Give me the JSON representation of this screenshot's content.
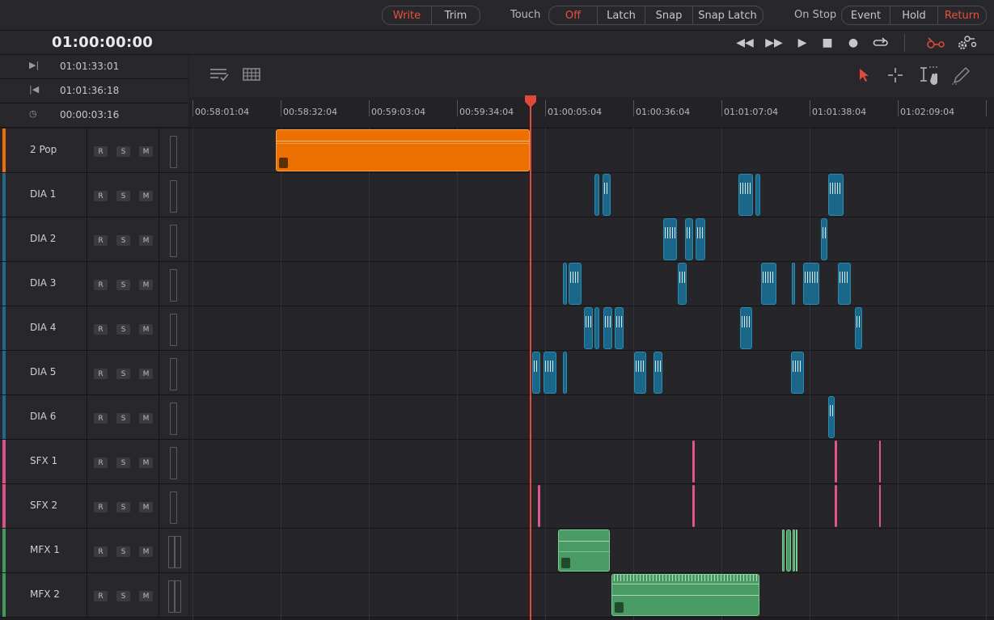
{
  "mode_buttons": [
    "Write",
    "Trim"
  ],
  "touch_label": "Touch",
  "automation_modes": [
    "Off",
    "Latch",
    "Snap",
    "Snap Latch"
  ],
  "onstop_label": "On Stop",
  "onstop_modes": [
    "Event",
    "Hold",
    "Return"
  ],
  "timecode": "01:00:00:00",
  "info": {
    "in_point": "01:01:33:01",
    "out_point": "01:01:36:18",
    "duration": "00:00:03:16"
  },
  "ruler_labels": [
    "00:58:01:04",
    "00:58:32:04",
    "00:59:03:04",
    "00:59:34:04",
    "01:00:05:04",
    "01:00:36:04",
    "01:01:07:04",
    "01:01:38:04",
    "01:02:09:04"
  ],
  "track_buttons": [
    "R",
    "S",
    "M"
  ],
  "tracks": [
    {
      "name": "2 Pop",
      "color": "#ec7000"
    },
    {
      "name": "DIA 1",
      "color": "#1d6a8c"
    },
    {
      "name": "DIA 2",
      "color": "#1d6a8c"
    },
    {
      "name": "DIA 3",
      "color": "#1d6a8c"
    },
    {
      "name": "DIA 4",
      "color": "#1d6a8c"
    },
    {
      "name": "DIA 5",
      "color": "#1d6a8c"
    },
    {
      "name": "DIA 6",
      "color": "#1d6a8c"
    },
    {
      "name": "SFX 1",
      "color": "#d9538b"
    },
    {
      "name": "SFX 2",
      "color": "#d9538b"
    },
    {
      "name": "MFX 1",
      "color": "#3f9a5c"
    },
    {
      "name": "MFX 2",
      "color": "#3f9a5c"
    }
  ],
  "colors": {
    "accent": "#e8503a",
    "playhead": "#e04a3a"
  },
  "icons": [
    "rewind-icon",
    "fast-forward-icon",
    "play-icon",
    "stop-icon",
    "record-icon",
    "loop-icon",
    "automation-icon",
    "settings-icon",
    "selection-tool-icon",
    "razor-tool-icon",
    "range-tool-icon",
    "pencil-tool-icon"
  ]
}
